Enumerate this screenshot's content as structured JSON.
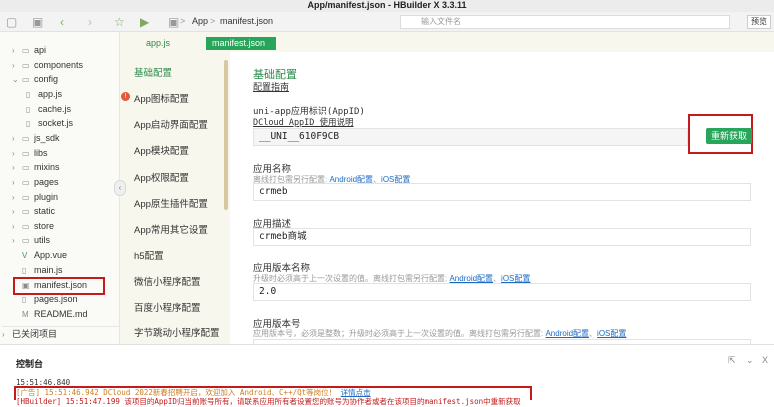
{
  "window": {
    "title": "App/manifest.json - HBuilder X 3.3.11"
  },
  "toolbar": {
    "breadcrumb": [
      "App",
      "manifest.json"
    ],
    "file_search_placeholder": "输入文件名",
    "preview_label": "预览"
  },
  "sidebar": {
    "items": [
      {
        "label": "api",
        "type": "folder"
      },
      {
        "label": "components",
        "type": "folder"
      },
      {
        "label": "config",
        "type": "folder-open"
      },
      {
        "label": "app.js",
        "type": "file"
      },
      {
        "label": "cache.js",
        "type": "file"
      },
      {
        "label": "socket.js",
        "type": "file"
      },
      {
        "label": "js_sdk",
        "type": "folder"
      },
      {
        "label": "libs",
        "type": "folder"
      },
      {
        "label": "mixins",
        "type": "folder"
      },
      {
        "label": "pages",
        "type": "folder"
      },
      {
        "label": "plugin",
        "type": "folder"
      },
      {
        "label": "static",
        "type": "folder"
      },
      {
        "label": "store",
        "type": "folder"
      },
      {
        "label": "utils",
        "type": "folder"
      },
      {
        "label": "App.vue",
        "type": "file"
      },
      {
        "label": "main.js",
        "type": "file"
      },
      {
        "label": "manifest.json",
        "type": "file"
      },
      {
        "label": "pages.json",
        "type": "file"
      },
      {
        "label": "README.md",
        "type": "file"
      }
    ],
    "footer": "已关闭项目"
  },
  "tabs": [
    {
      "label": "app.js",
      "active": false
    },
    {
      "label": "manifest.json",
      "active": true
    }
  ],
  "settings_nav": [
    "基础配置",
    "App图标配置",
    "App启动界面配置",
    "App模块配置",
    "App权限配置",
    "App原生插件配置",
    "App常用其它设置",
    "h5配置",
    "微信小程序配置",
    "百度小程序配置",
    "字节跳动小程序配置"
  ],
  "main": {
    "title": "基础配置",
    "guide_link": "配置指南",
    "appid_label": "uni-app应用标识(AppID)",
    "appid_help": "DCloud AppID 使用说明",
    "appid_value": "__UNI__610F9CB",
    "regen_button": "重新获取",
    "name_label": "应用名称",
    "name_sub_prefix": "离线打包需另行配置:",
    "name_sub_android": "Android配置",
    "name_sub_ios": "iOS配置",
    "name_value": "crmeb",
    "desc_label": "应用描述",
    "desc_value": "crmeb商城",
    "version_name_label": "应用版本名称",
    "version_name_sub": "升级时必须高于上一次设置的值。离线打包需另行配置:",
    "version_name_value": "2.0",
    "version_code_label": "应用版本号",
    "version_code_sub": "应用版本号，必须是整数；升级时必须高于上一次设置的值。离线打包需另行配置:"
  },
  "console": {
    "tab_label": "控制台",
    "lines": [
      {
        "text": "15:51:46.840"
      },
      {
        "text": "[广告] 15:51:46.942 DCloud 2022新春招聘开启，欢迎加入 Android、C++/Qt等岗位！",
        "link": "详情点击"
      },
      {
        "text": "[HBuilder] 15:51:47.199 该项目的AppID归当前账号所有，请联系应用所有者设置您的账号为协作者或者在该项目的manifest.json中重新获取"
      }
    ]
  },
  "colors": {
    "accent": "#27a55a",
    "highlight": "#c41a1a",
    "link": "#1c6ac4"
  }
}
